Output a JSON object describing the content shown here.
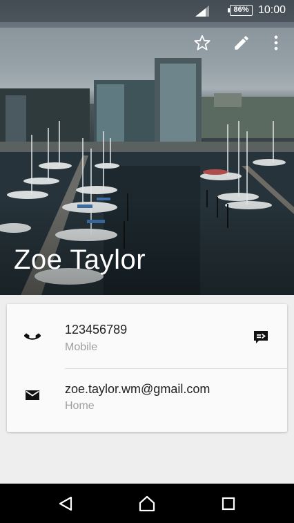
{
  "status_bar": {
    "battery": "86%",
    "time": "10:00",
    "icons": [
      "signal-icon",
      "battery-icon"
    ]
  },
  "toolbar": {
    "icons": [
      "star-outline-icon",
      "edit-pencil-icon",
      "more-vert-icon"
    ]
  },
  "contact": {
    "name": "Zoe Taylor",
    "header_image": "harbor-marina-photo"
  },
  "details": {
    "phone": {
      "icon": "phone-icon",
      "number": "123456789",
      "type": "Mobile",
      "action_icon": "message-icon"
    },
    "email": {
      "icon": "email-icon",
      "address": "zoe.taylor.wm@gmail.com",
      "type": "Home"
    }
  },
  "nav_bar": {
    "icons": [
      "back-icon",
      "home-icon",
      "recent-apps-icon"
    ]
  },
  "colors": {
    "card_background": "#fafafa",
    "screen_background": "#eeeeee",
    "secondary_text": "#9e9e9e",
    "primary_text": "#212121"
  }
}
